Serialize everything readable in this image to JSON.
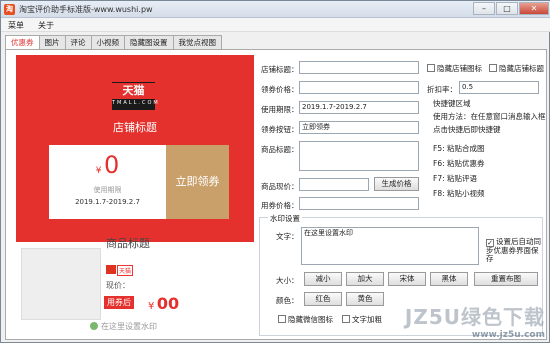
{
  "window": {
    "title": "淘宝评价助手标准版-www.wushi.pw",
    "app_icon": "淘"
  },
  "menu": [
    {
      "label": "菜单"
    },
    {
      "label": "关于"
    }
  ],
  "tabs": [
    {
      "label": "优惠券"
    },
    {
      "label": "图片"
    },
    {
      "label": "评论"
    },
    {
      "label": "小视频"
    },
    {
      "label": "隐藏图设置"
    },
    {
      "label": "我觉点视图"
    }
  ],
  "preview": {
    "logo_text": "天猫",
    "logo_sub": "TMALL.COM",
    "shop_title": "店铺标题",
    "coupon_yen": "¥",
    "coupon_value": "0",
    "coupon_condition": "使用期限",
    "coupon_dates": "2019.1.7-2019.2.7",
    "coupon_button": "立即领券",
    "goods_title": "商品标题",
    "tmall_badge": "天猫",
    "now_price_label": "现价：",
    "after_coupon_badge": "用券后",
    "after_yen": "¥",
    "after_value": "00",
    "watermark": "在这里设置水印"
  },
  "form": {
    "shop_title_label": "店铺标题：",
    "coupon_price_label": "领券价格：",
    "use_period_label": "使用期限：",
    "use_period_value": "2019.1.7-2019.2.7",
    "coupon_button_label": "领券按钮：",
    "coupon_button_value": "立即领券",
    "goods_title_label": "商品标题：",
    "goods_now_price_label": "商品现价：",
    "after_price_label": "用券价格：",
    "generate_price_button": "生成价格",
    "hide_shop_icon": "隐藏店铺图标",
    "hide_shop_title": "隐藏店铺标题",
    "discount_label": "折扣率：",
    "discount_value": "0.5",
    "shortcut_title": "快捷键区域",
    "shortcut_desc": "使用方法：在任意窗口消息输入框",
    "shortcut_desc2": "点击快捷后即快捷键",
    "hotkeys": [
      {
        "key": "F5:",
        "label": "粘贴合成图"
      },
      {
        "key": "F6:",
        "label": "粘贴优惠券"
      },
      {
        "key": "F7:",
        "label": "粘贴评语"
      },
      {
        "key": "F8:",
        "label": "粘贴小视频"
      }
    ],
    "watermark_group_title": "水印设置",
    "text_label": "文字：",
    "text_value": "在这里设置水印",
    "persist_option": "设置后自动同步优惠券界面保存",
    "size_label": "大小：",
    "size_minus": "减小",
    "size_plus": "加大",
    "font_song": "宋体",
    "font_hei": "黑体",
    "redraw": "重置布图",
    "color_label": "颜色：",
    "color_red": "红色",
    "color_yellow": "黄色",
    "hide_watermark_icon": "隐藏微信图标",
    "bold_text": "文字加粗"
  },
  "brand_watermark": {
    "big": "JZ5U绿色下载",
    "small": "www.jz5u.com"
  },
  "colors": {
    "accent_red": "#e5312d",
    "coupon_gold": "#c9a06a"
  }
}
